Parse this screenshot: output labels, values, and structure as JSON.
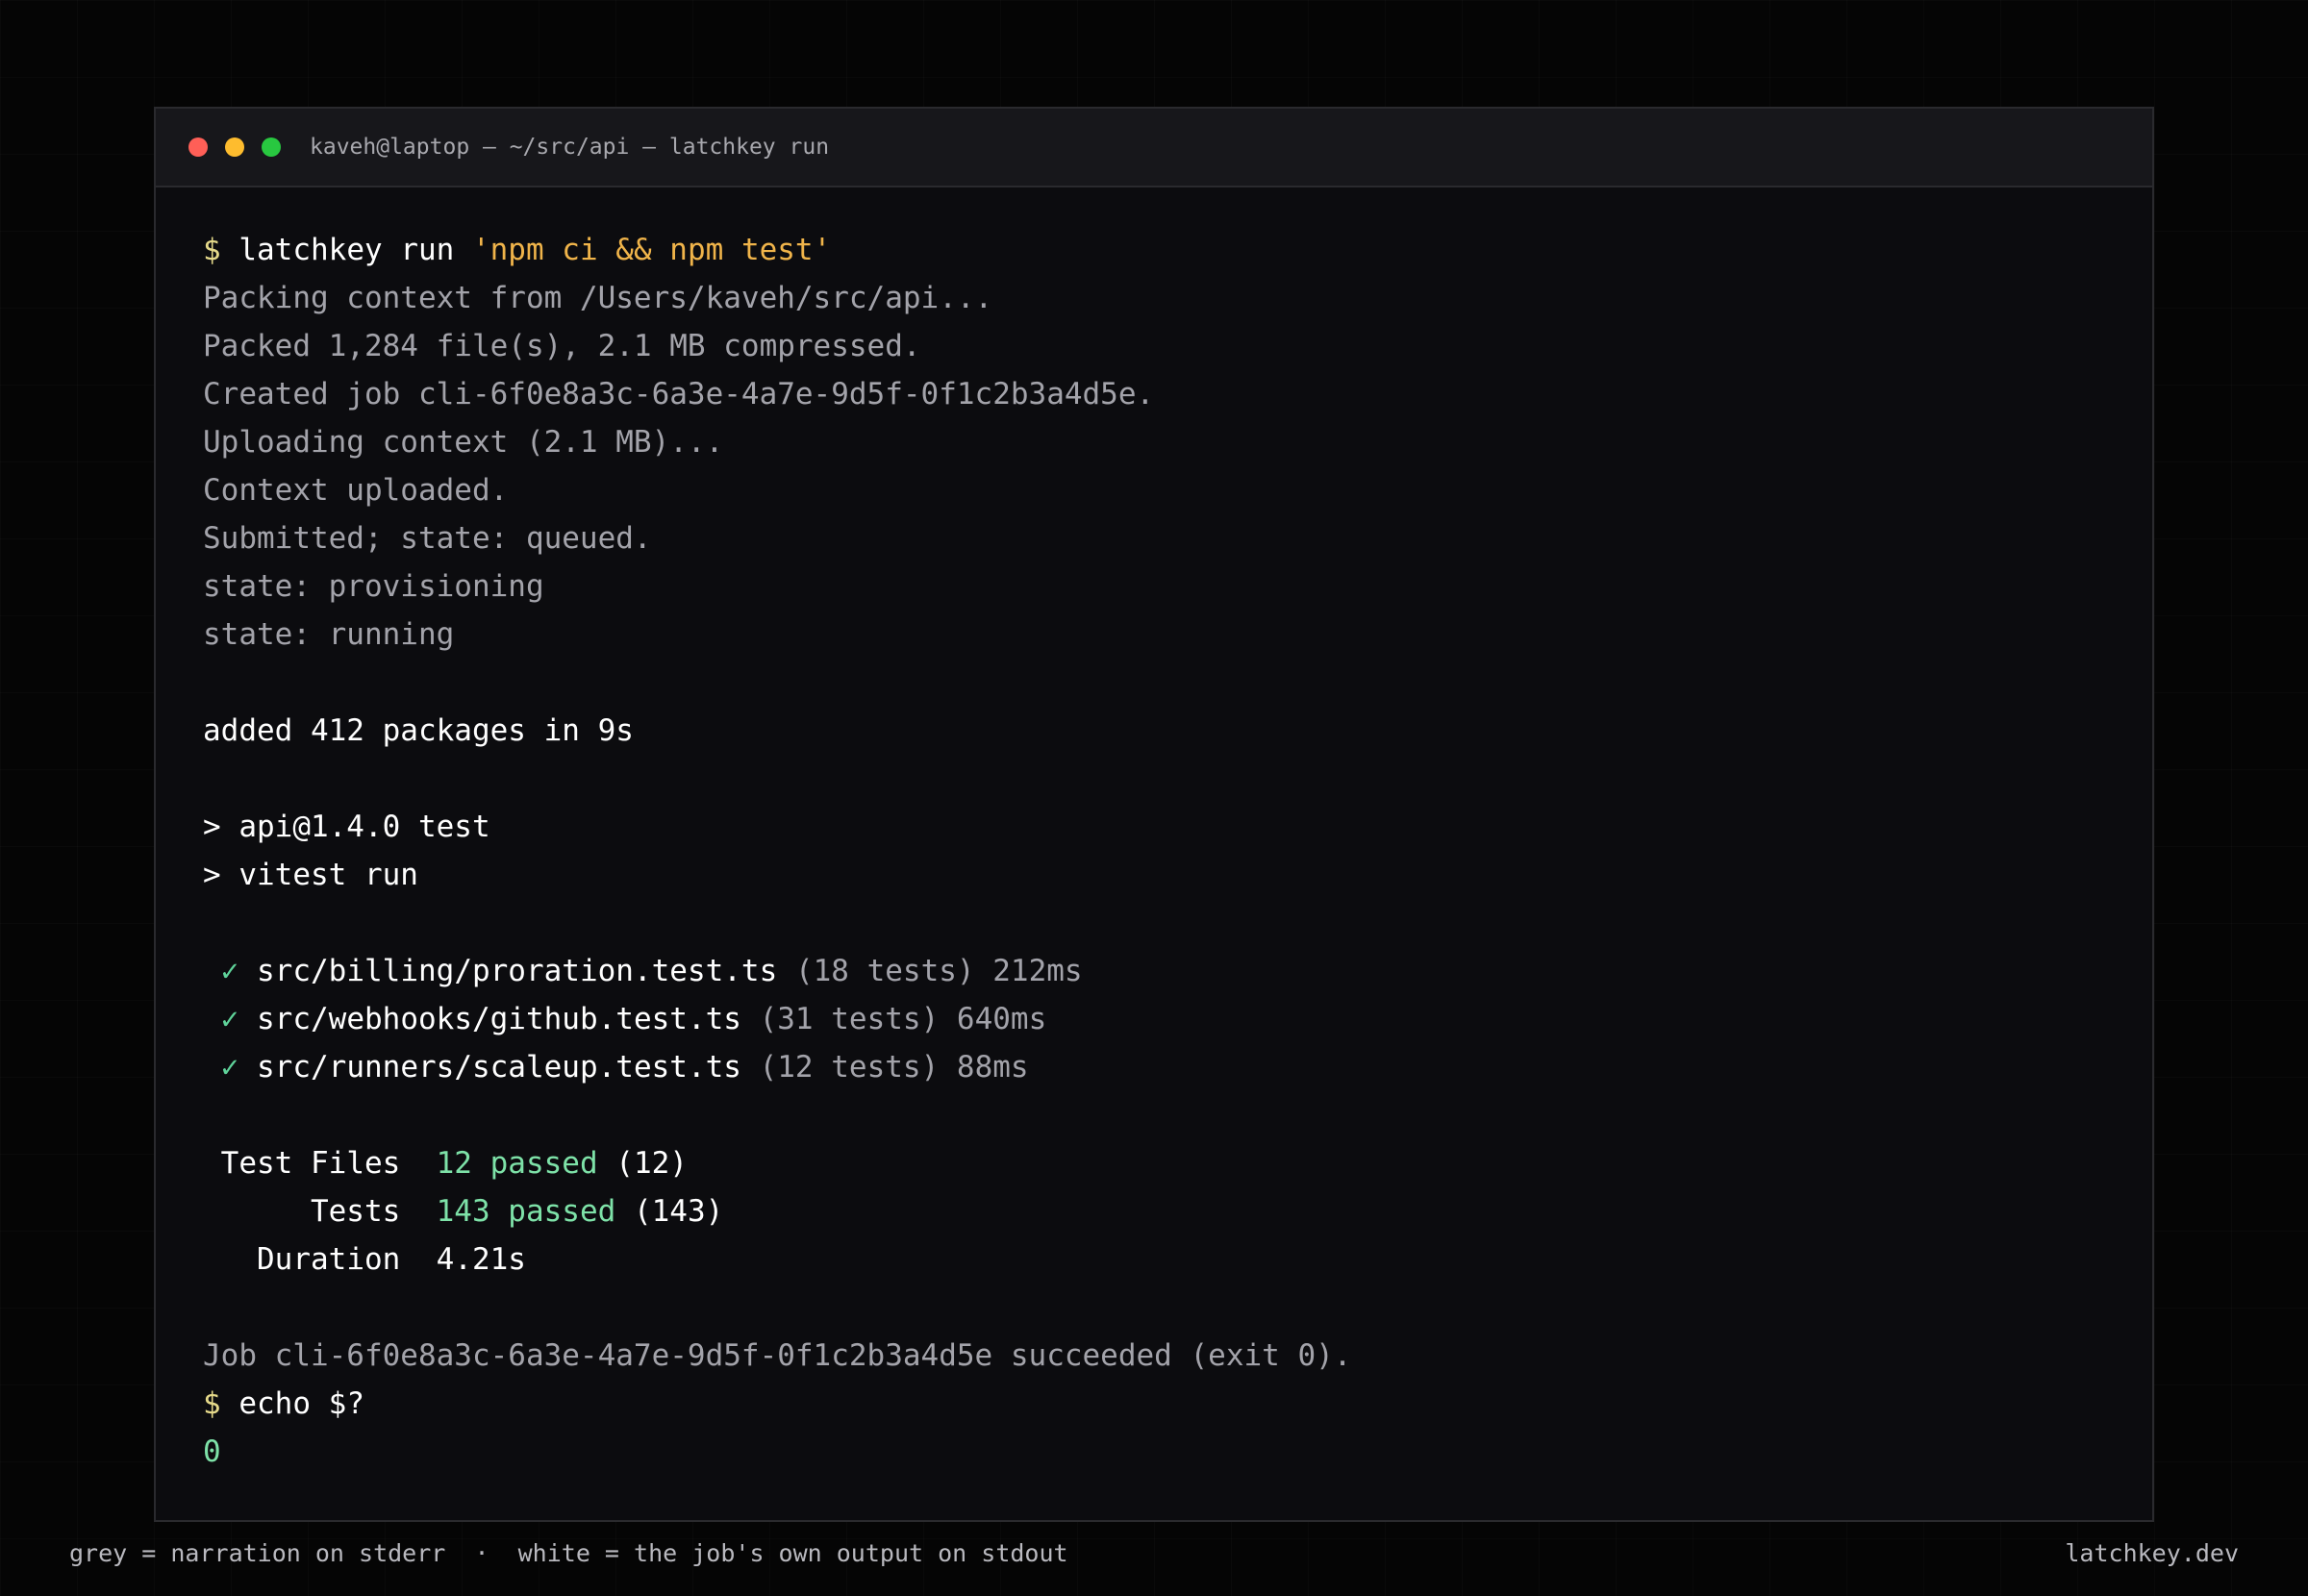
{
  "window": {
    "title": "kaveh@laptop — ~/src/api — latchkey run",
    "controls": {
      "close": "close-icon",
      "minimize": "minimize-icon",
      "maximize": "maximize-icon"
    }
  },
  "colors": {
    "background": "#050505",
    "terminal_bg": "#0c0c0f",
    "titlebar_bg": "#17171b",
    "narration_grey": "#a3a3aa",
    "stdout_white": "#ffffff",
    "prompt": "#e5d98a",
    "command_string": "#f0b44a",
    "success_green": "#7ee2a8",
    "close": "#ff5f57",
    "minimize": "#febc2e",
    "maximize": "#28c840"
  },
  "terminal": {
    "prompt_symbol": "$",
    "command1": {
      "program": "latchkey run",
      "argument": "'npm ci && npm test'"
    },
    "narration": [
      "Packing context from /Users/kaveh/src/api...",
      "Packed 1,284 file(s), 2.1 MB compressed.",
      "Created job cli-6f0e8a3c-6a3e-4a7e-9d5f-0f1c2b3a4d5e.",
      "Uploading context (2.1 MB)...",
      "Context uploaded.",
      "Submitted; state: queued.",
      "state: provisioning",
      "state: running"
    ],
    "npm_added": "added 412 packages in 9s",
    "script_lines": [
      "> api@1.4.0 test",
      "> vitest run"
    ],
    "check_mark": "✓",
    "test_results": [
      {
        "file": "src/billing/proration.test.ts",
        "meta": "(18 tests) 212ms"
      },
      {
        "file": "src/webhooks/github.test.ts",
        "meta": "(31 tests) 640ms"
      },
      {
        "file": "src/runners/scaleup.test.ts",
        "meta": "(12 tests) 88ms"
      }
    ],
    "summary": {
      "files_label": "Test Files",
      "files_passed": "12 passed",
      "files_total": "(12)",
      "tests_label": "Tests",
      "tests_passed": "143 passed",
      "tests_total": "(143)",
      "duration_label": "Duration",
      "duration_value": "4.21s"
    },
    "job_status": "Job cli-6f0e8a3c-6a3e-4a7e-9d5f-0f1c2b3a4d5e succeeded (exit 0).",
    "command2": "echo $?",
    "exit_code": "0"
  },
  "footer": {
    "legend_grey": "grey = narration on stderr",
    "separator": "·",
    "legend_white": "white = the job's own output on stdout",
    "brand": "latchkey.dev"
  }
}
